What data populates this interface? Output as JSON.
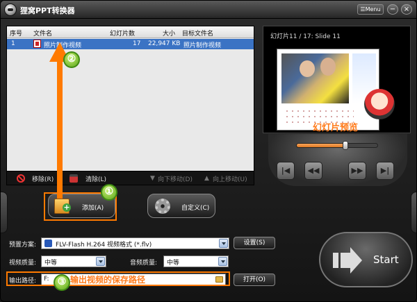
{
  "window": {
    "title": "狸窝PPT转换器",
    "menu_label": "Menu",
    "min_glyph": "−",
    "close_glyph": "×"
  },
  "file_list": {
    "headers": [
      "序号",
      "文件名",
      "幻灯片数",
      "大小",
      "目标文件名"
    ],
    "rows": [
      {
        "index": "1",
        "name": "照片制作视频",
        "slides": "17",
        "size": "22,947 KB",
        "target": "照片制作视频"
      }
    ]
  },
  "list_actions": {
    "remove": "移除(R)",
    "clear": "清除(L)",
    "move_down": "向下移动(D)",
    "move_up": "向上移动(U)"
  },
  "preview": {
    "caption": "幻灯片11 / 17: Slide 11",
    "overlay_label": "幻灯片预览",
    "progress": 0.6
  },
  "player": {
    "first": "|◀",
    "prev": "◀◀",
    "next": "▶▶",
    "last": "▶|"
  },
  "buttons": {
    "add": "添加(A)",
    "customize": "自定义(C)",
    "settings": "设置(S)",
    "open": "打开(O)",
    "start": "Start"
  },
  "settings": {
    "preset_label": "预置方案:",
    "preset_value": "FLV-Flash H.264 视频格式 (*.flv)",
    "video_quality_label": "视频质量:",
    "video_quality_value": "中等",
    "audio_quality_label": "音频质量:",
    "audio_quality_value": "中等",
    "output_label": "输出路径:",
    "output_value": "F:"
  },
  "annotations": {
    "step1": "①",
    "step2": "②",
    "step3": "③",
    "output_hint": "输出视频的保存路径"
  },
  "colors": {
    "accent_orange": "#ff7a00",
    "selection_blue": "#3b73c4",
    "annotation_green": "#5aa51a"
  }
}
